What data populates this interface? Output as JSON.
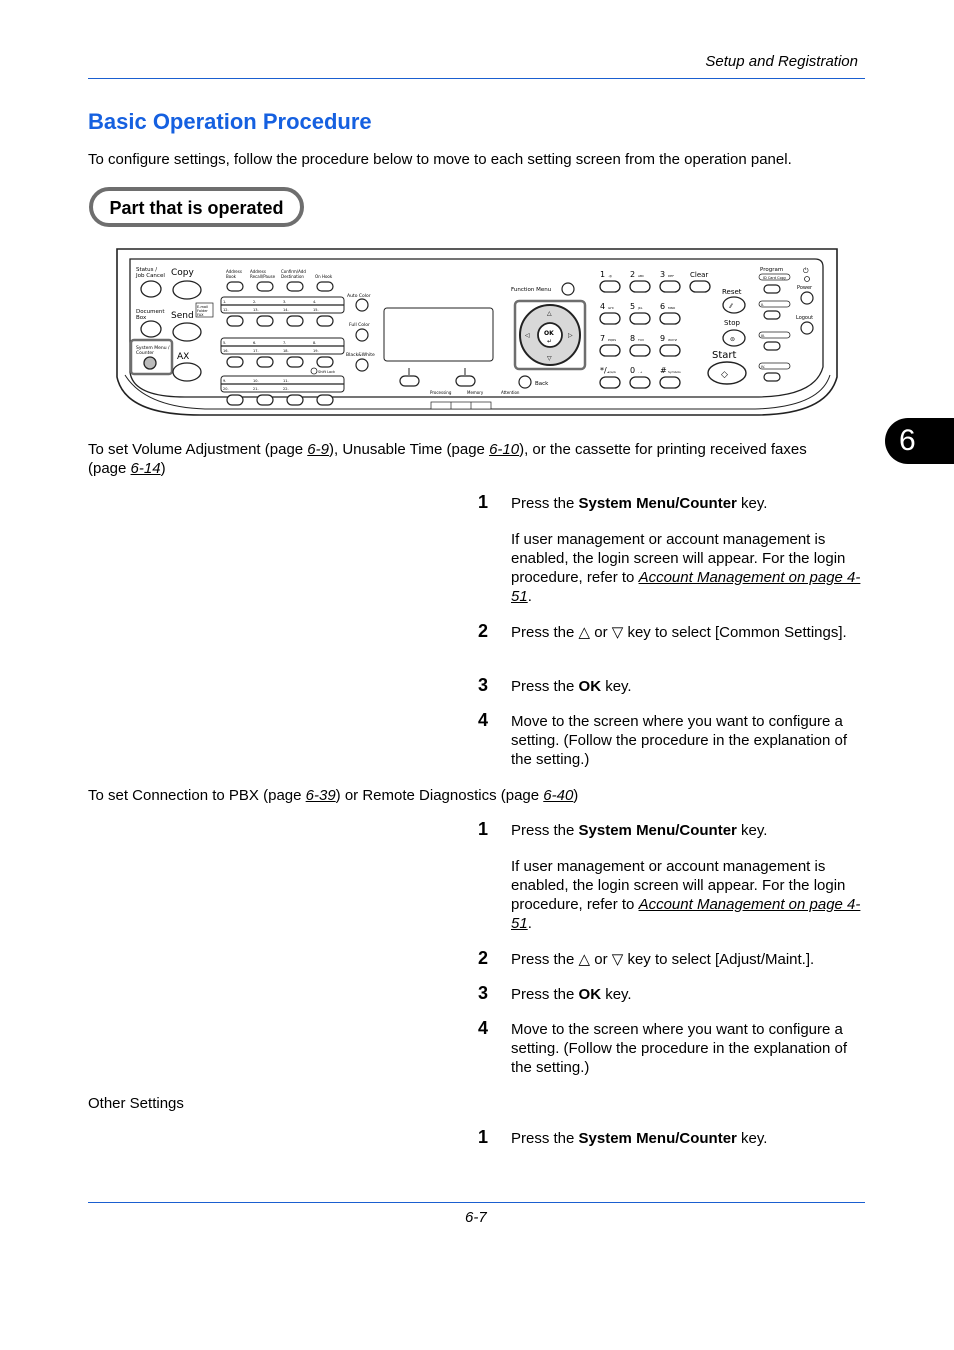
{
  "header": {
    "section_title": "Setup and Registration"
  },
  "page_title": "Basic Operation Procedure",
  "intro": "To configure settings, follow the procedure below to move to each setting screen from the operation panel.",
  "part_label": "Part that is operated",
  "panel": {
    "left_keys": {
      "status": "Status /",
      "status2": "Job Cancel",
      "copy": "Copy",
      "docbox": "Document",
      "docbox2": "Box",
      "send": "Send",
      "send_sub1": "E-mail",
      "send_sub2": "Folder",
      "send_sub3": "FAX",
      "sysmenu": "System Menu /",
      "sysmenu2": "Counter",
      "fax": "AX"
    },
    "top_keys": [
      "Address",
      "Book",
      "Address",
      "Recall/Pause",
      "Confirm/Add",
      "Destination",
      "On Hook"
    ],
    "color_keys": [
      "Auto Color",
      "Full Color",
      "Black&White"
    ],
    "function_menu": "Function Menu",
    "ok": "OK",
    "back": "Back",
    "indicators": [
      "Processing",
      "Memory",
      "Attention"
    ],
    "numpad": [
      "1",
      "2",
      "3",
      "Clear",
      "4",
      "5",
      "6",
      "7",
      "8",
      "9",
      "*/.",
      "0",
      "#"
    ],
    "numpad_sub": [
      ".@",
      "ABC",
      "DEF",
      "GHI",
      "JKL",
      "MNO",
      "PQRS",
      "TUV",
      "WXYZ",
      "1/a/A",
      ". +",
      "Symbols"
    ],
    "reset": "Reset",
    "stop": "Stop",
    "start": "Start",
    "program": "Program",
    "idcard": "ID Card Copy",
    "power": "Power",
    "logout": "Logout",
    "program_slots": [
      "II.",
      "III.",
      "IV."
    ],
    "shift_lock": "Shift Lock",
    "one_touch": [
      [
        "1.",
        "2.",
        "3.",
        "4."
      ],
      [
        "12.",
        "13.",
        "14.",
        "15."
      ],
      [
        "5.",
        "6.",
        "7.",
        "8."
      ],
      [
        "16.",
        "17.",
        "18.",
        "19."
      ],
      [
        "9.",
        "10.",
        "11."
      ],
      [
        "20.",
        "21.",
        "22."
      ]
    ]
  },
  "section1": {
    "text_before": "To set Volume Adjustment (page ",
    "link1": "6-9",
    "text_mid1": "), Unusable Time (page ",
    "link2": "6-10",
    "text_mid2": "), or the cassette for printing received faxes",
    "text_line2_before": "(page ",
    "link3": "6-14",
    "text_line2_after": ")",
    "steps": [
      {
        "num": "1",
        "pre": "Press the ",
        "bold": "System Menu/Counter",
        "post": " key.",
        "note_pre": "If user management or account management is enabled, the login screen will appear. For the login procedure, refer to ",
        "note_link": "Account Management on page 4-51",
        "note_post": "."
      },
      {
        "num": "2",
        "text": "Press the △ or ▽ key to select [Common Settings]."
      },
      {
        "num": "3",
        "pre": "Press the ",
        "bold": "OK",
        "post": " key."
      },
      {
        "num": "4",
        "text": "Move to the screen where you want to configure a setting. (Follow the procedure in the explanation of the setting.)"
      }
    ]
  },
  "section2": {
    "text_before": "To set Connection to PBX (page ",
    "link1": "6-39",
    "text_mid": ") or Remote Diagnostics (page ",
    "link2": "6-40",
    "text_after": ")",
    "steps": [
      {
        "num": "1",
        "pre": "Press the ",
        "bold": "System Menu/Counter",
        "post": " key.",
        "note_pre": "If user management or account management is enabled, the login screen will appear. For the login procedure, refer to ",
        "note_link": "Account Management on page 4-51",
        "note_post": "."
      },
      {
        "num": "2",
        "text": "Press the △ or ▽ key to select [Adjust/Maint.]."
      },
      {
        "num": "3",
        "pre": "Press the ",
        "bold": "OK",
        "post": " key."
      },
      {
        "num": "4",
        "text": "Move to the screen where you want to configure a setting. (Follow the procedure in the explanation of the setting.)"
      }
    ]
  },
  "section3": {
    "title": "Other Settings",
    "steps": [
      {
        "num": "1",
        "pre": "Press the ",
        "bold": "System Menu/Counter",
        "post": " key."
      }
    ]
  },
  "chapter_tab": "6",
  "footer": {
    "page_number": "6-7"
  },
  "colors": {
    "accent": "#1560e0",
    "rule": "#1a5fd0",
    "highlight_frame": "#6e6e6e"
  }
}
